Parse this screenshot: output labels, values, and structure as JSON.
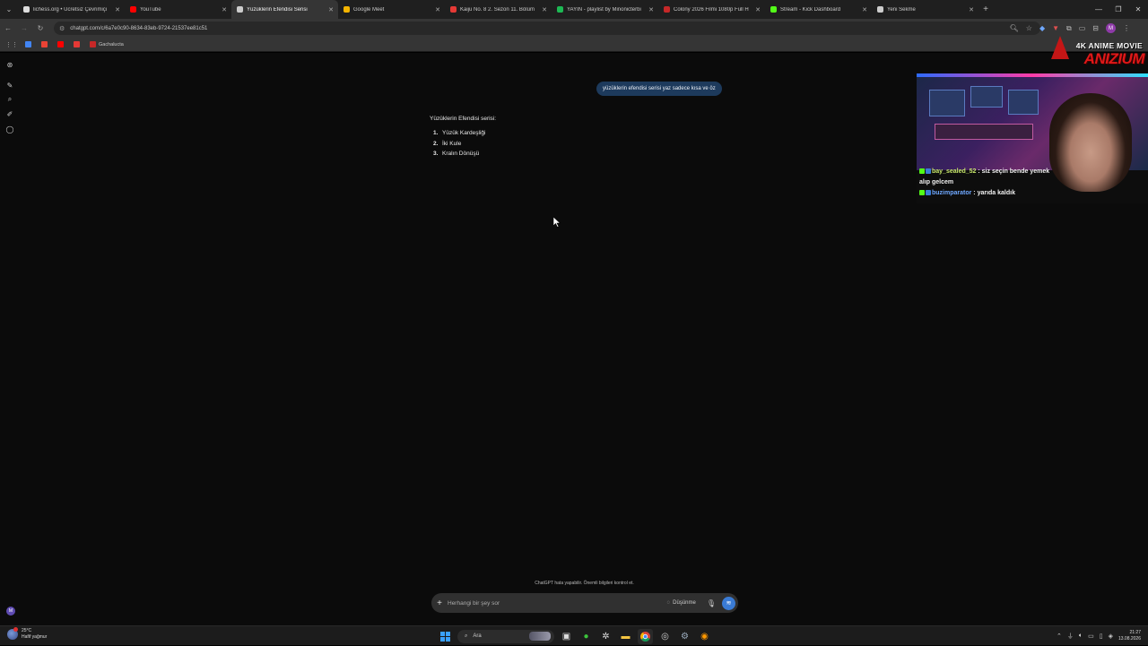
{
  "browser": {
    "tabs": [
      {
        "label": "lichess.org • Ücretsiz Çevrimiçi",
        "color": "#dddddd",
        "active": false
      },
      {
        "label": "YouTube",
        "color": "#ff0000",
        "active": false
      },
      {
        "label": "Yüzüklerin Efendisi Serisi",
        "color": "#cccccc",
        "active": true
      },
      {
        "label": "Google Meet",
        "color": "#f4b400",
        "active": false
      },
      {
        "label": "Kaiju No. 8 2. Sezon 11. Bölüm",
        "color": "#e53935",
        "active": false
      },
      {
        "label": "YAYIN - playlist by Minonicterbi",
        "color": "#1db954",
        "active": false
      },
      {
        "label": "Colony 2026 Filmi 1080p Full H",
        "color": "#c62828",
        "active": false
      },
      {
        "label": "Stream - Kick Dashboard",
        "color": "#53fc18",
        "active": false
      },
      {
        "label": "Yeni Sekme",
        "color": "#cccccc",
        "active": false
      }
    ],
    "url": "chatgpt.com/c/6a7e0c90-8634-83eb-9724-21537ee81c51",
    "bookmarks": [
      {
        "label": "",
        "color": "#4285f4"
      },
      {
        "label": "",
        "color": "#ea4335"
      },
      {
        "label": "",
        "color": "#ff0000"
      },
      {
        "label": "",
        "color": "#e53935"
      },
      {
        "label": "Gachalucta",
        "color": "#c62828"
      }
    ]
  },
  "chat": {
    "user_message": "yüzüklerin efendisi serisi yaz sadece kısa ve öz",
    "answer_heading": "Yüzüklerin Efendisi serisi:",
    "answer_items": [
      {
        "num": "1.",
        "text": "Yüzük Kardeşliği"
      },
      {
        "num": "2.",
        "text": "İki Kule"
      },
      {
        "num": "3.",
        "text": "Kralın Dönüşü"
      }
    ],
    "disclaimer": "ChatGPT hata yapabilir. Önemli bilgileri kontrol et.",
    "composer_placeholder": "Herhangi bir şey sor",
    "think_label": "Düşünme"
  },
  "stream_overlay": {
    "logo_top": "4K ANIME MOVIE",
    "logo_brand": "ANIZIUM",
    "messages": [
      {
        "user": "bay_sealed_52",
        "text": " : siz seçin bende yemek alıp gelcem"
      },
      {
        "user": "buzimparator",
        "text": " : yarıda kaldık"
      }
    ]
  },
  "taskbar": {
    "weather_temp": "25°C",
    "weather_desc": "Hafif yağmur",
    "search_label": "Ara",
    "time": "21:27",
    "date": "13.08.2026"
  }
}
